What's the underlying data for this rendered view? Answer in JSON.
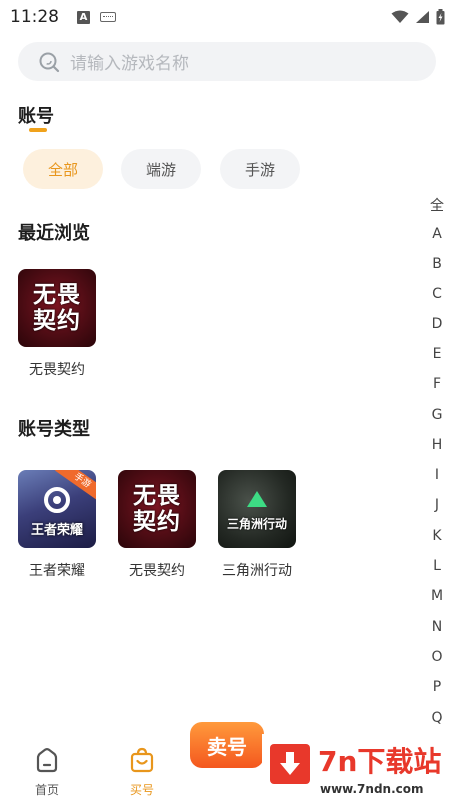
{
  "status_bar": {
    "time": "11:28",
    "a_badge": "A"
  },
  "search": {
    "placeholder": "请输入游戏名称"
  },
  "account_section": {
    "title": "账号"
  },
  "filter_tabs": [
    {
      "label": "全部",
      "active": true
    },
    {
      "label": "端游",
      "active": false
    },
    {
      "label": "手游",
      "active": false
    }
  ],
  "recent_section": {
    "title": "最近浏览",
    "items": [
      {
        "name": "无畏契约",
        "thumb_text": "无畏契约"
      }
    ]
  },
  "types_section": {
    "title": "账号类型",
    "items": [
      {
        "name": "王者荣耀",
        "thumb_text": "王者荣耀",
        "badge": "手游"
      },
      {
        "name": "无畏契约",
        "thumb_text": "无畏契约"
      },
      {
        "name": "三角洲行动",
        "thumb_text": "三角洲行动"
      }
    ]
  },
  "alpha_index": [
    "全",
    "A",
    "B",
    "C",
    "D",
    "E",
    "F",
    "G",
    "H",
    "I",
    "J",
    "K",
    "L",
    "M",
    "N",
    "O",
    "P",
    "Q"
  ],
  "bottom_nav": {
    "home": "首页",
    "buy": "买号",
    "sell": "卖号"
  },
  "watermark": {
    "title": "7n下载站",
    "url": "www.7ndn.com"
  },
  "colors": {
    "accent": "#e8961c",
    "sell_gradient_top": "#ff9a3c",
    "sell_gradient_bottom": "#f4571e"
  }
}
